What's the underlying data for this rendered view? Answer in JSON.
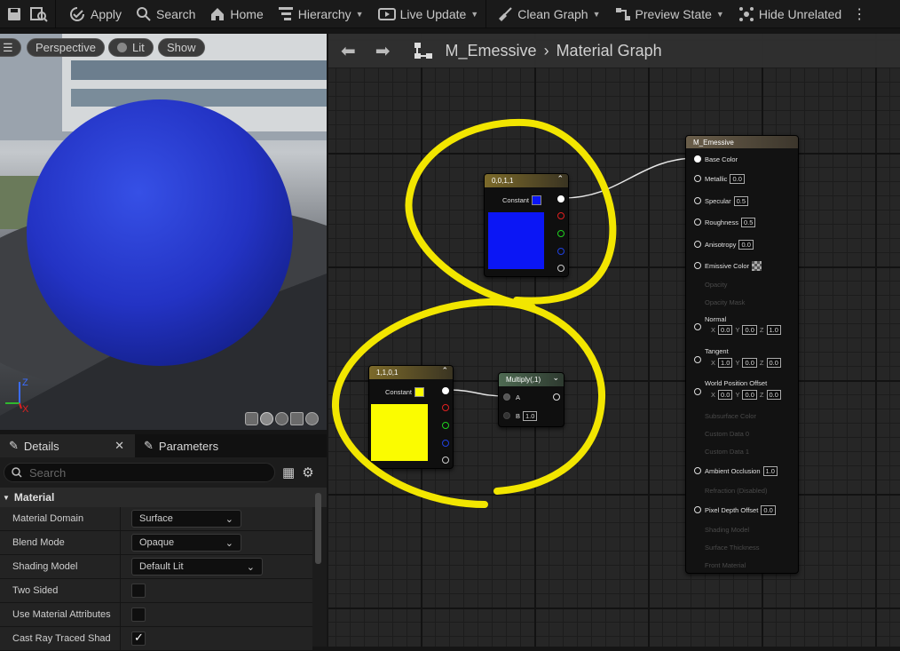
{
  "toolbar": {
    "apply": "Apply",
    "search": "Search",
    "home": "Home",
    "hierarchy": "Hierarchy",
    "live_update": "Live Update",
    "clean_graph": "Clean Graph",
    "preview_state": "Preview State",
    "hide_unrelated": "Hide Unrelated"
  },
  "viewport": {
    "perspective": "Perspective",
    "lit": "Lit",
    "show": "Show",
    "axis_z": "Z",
    "axis_x": "X"
  },
  "details": {
    "tab_details": "Details",
    "tab_parameters": "Parameters",
    "search_placeholder": "Search",
    "category": "Material",
    "props": [
      {
        "label": "Material Domain",
        "value": "Surface"
      },
      {
        "label": "Blend Mode",
        "value": "Opaque"
      },
      {
        "label": "Shading Model",
        "value": "Default Lit"
      },
      {
        "label": "Two Sided",
        "value": ""
      },
      {
        "label": "Use Material Attributes",
        "value": ""
      },
      {
        "label": "Cast Ray Traced Shad",
        "value": ""
      }
    ]
  },
  "graph": {
    "asset": "M_Emessive",
    "view": "Material Graph",
    "node_blue": {
      "title": "0,0,1,1",
      "pin": "Constant",
      "color": "#0b16f5"
    },
    "node_yellow": {
      "title": "1,1,0,1",
      "pin": "Constant",
      "color": "#fbfc00"
    },
    "node_mult": {
      "title": "Multiply(,1)",
      "a": "A",
      "b": "B",
      "b_value": "1.0"
    },
    "result": {
      "title": "M_Emessive",
      "base_color": "Base Color",
      "metallic": "Metallic",
      "metallic_v": "0.0",
      "specular": "Specular",
      "specular_v": "0.5",
      "roughness": "Roughness",
      "roughness_v": "0.5",
      "anisotropy": "Anisotropy",
      "anisotropy_v": "0.0",
      "emissive": "Emissive Color",
      "opacity": "Opacity",
      "opacity_mask": "Opacity Mask",
      "normal": "Normal",
      "normal_x": "0.0",
      "normal_y": "0.0",
      "normal_z": "1.0",
      "tangent": "Tangent",
      "tangent_x": "1.0",
      "tangent_y": "0.0",
      "tangent_z": "0.0",
      "wpo": "World Position Offset",
      "wpo_x": "0.0",
      "wpo_y": "0.0",
      "wpo_z": "0.0",
      "subsurface": "Subsurface Color",
      "cd0": "Custom Data 0",
      "cd1": "Custom Data 1",
      "ao": "Ambient Occlusion",
      "ao_v": "1.0",
      "refraction": "Refraction (Disabled)",
      "pdo": "Pixel Depth Offset",
      "pdo_v": "0.0",
      "shading_model": "Shading Model",
      "surface_thickness": "Surface Thickness",
      "front_material": "Front Material",
      "x": "X",
      "y": "Y",
      "z": "Z"
    }
  },
  "colors": {
    "highlight": "#f2e600",
    "sphere": "#2a3ed0"
  }
}
